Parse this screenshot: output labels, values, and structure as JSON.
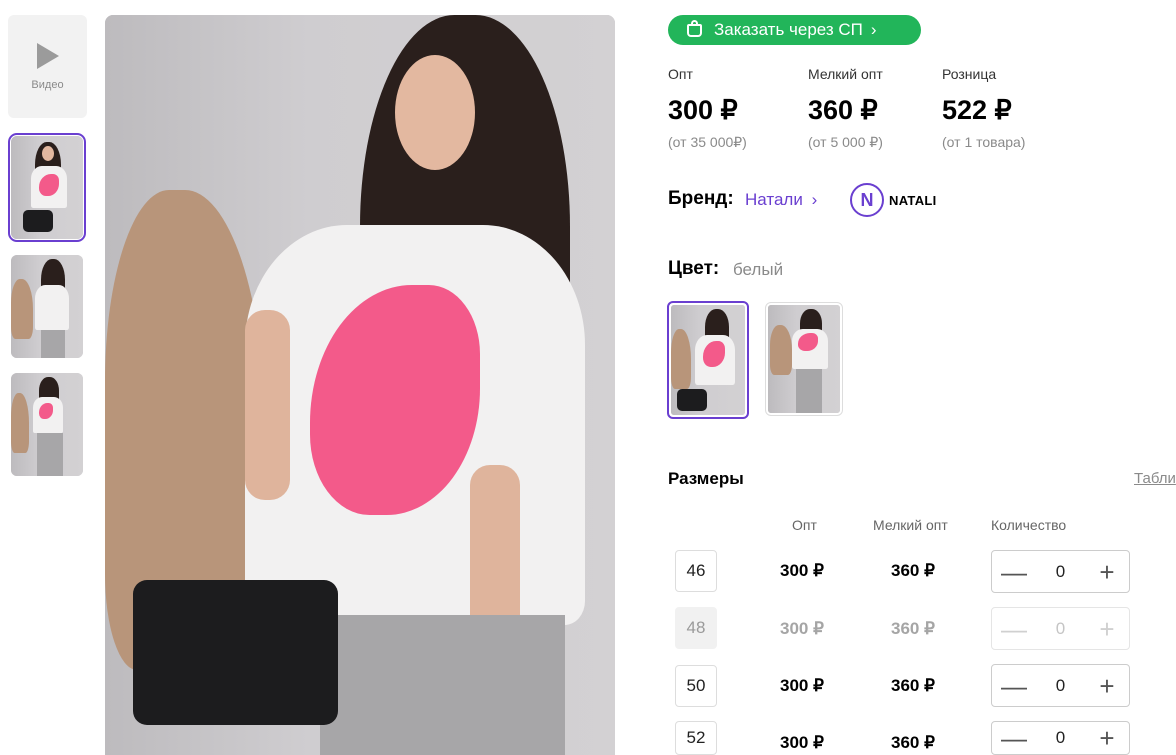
{
  "gallery": {
    "video_label": "Видео"
  },
  "order_button": {
    "label": "Заказать через СП"
  },
  "prices": [
    {
      "label": "Опт",
      "value": "300 ₽",
      "note": "(от 35 000₽)"
    },
    {
      "label": "Мелкий опт",
      "value": "360 ₽",
      "note": "(от 5 000 ₽)"
    },
    {
      "label": "Розница",
      "value": "522 ₽",
      "note": "(от 1 товара)"
    }
  ],
  "brand": {
    "label": "Бренд:",
    "name": "Натали",
    "logo_letter": "N",
    "logo_text": "NATALI"
  },
  "color": {
    "label": "Цвет:",
    "value": "белый"
  },
  "sizes": {
    "title": "Размеры",
    "table_link": "Табли",
    "columns": {
      "opt": "Опт",
      "small_opt": "Мелкий опт",
      "qty": "Количество"
    },
    "rows": [
      {
        "size": "46",
        "opt": "300 ₽",
        "small_opt": "360 ₽",
        "qty": "0",
        "available": true
      },
      {
        "size": "48",
        "opt": "300 ₽",
        "small_opt": "360 ₽",
        "qty": "0",
        "available": false
      },
      {
        "size": "50",
        "opt": "300 ₽",
        "small_opt": "360 ₽",
        "qty": "0",
        "available": true
      },
      {
        "size": "52",
        "opt": "300 ₽",
        "small_opt": "360 ₽",
        "qty": "0",
        "available": true
      }
    ],
    "minus_symbol": "—",
    "plus_symbol": "+"
  },
  "colors": {
    "accent": "#6a3fd0",
    "order_green": "#22b55a"
  }
}
